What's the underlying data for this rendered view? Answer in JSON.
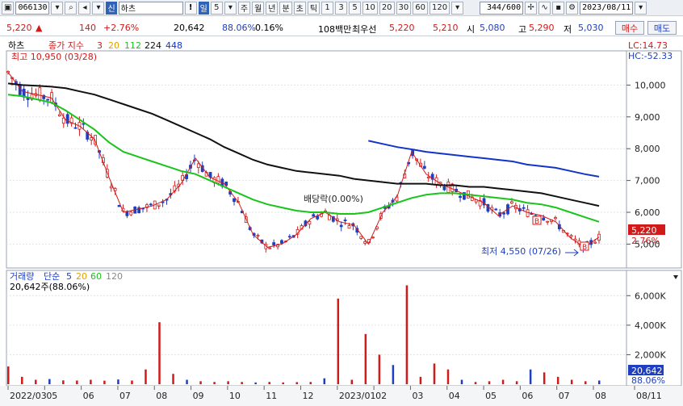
{
  "toolbar": {
    "code": "066130",
    "market_tag": "신",
    "name": "하츠",
    "warn": "!",
    "period_tag": "일",
    "period_num": "5",
    "periods": [
      "주",
      "월",
      "년",
      "분",
      "초",
      "틱"
    ],
    "intervals": [
      "1",
      "3",
      "5",
      "10",
      "20",
      "30",
      "60",
      "120"
    ],
    "count": "344/600",
    "date": "2023/08/11"
  },
  "quote": {
    "price": "5,220",
    "change": "140",
    "change_pct": "+2.76%",
    "volume": "20,642",
    "volume_ratio": "88.06%",
    "turnover": "0.16%",
    "amount_label": "108백만",
    "best_label": "최우선",
    "ask": "5,220",
    "bid": "5,210",
    "open_label": "시",
    "open": "5,080",
    "high_label": "고",
    "high": "5,290",
    "low_label": "저",
    "low": "5,030",
    "buy_label": "매수",
    "sell_label": "매도"
  },
  "price_panel": {
    "name_tag": "하츠",
    "legend_prefix": "종가 지수",
    "ma_periods": [
      "3",
      "20",
      "112",
      "224",
      "448"
    ],
    "high_note": "최고 10,950 (03/28)",
    "low_note": "최저 4,550 (07/26)",
    "dividend_note": "배당락(0.00%)",
    "lc": "LC:14.73",
    "hc": "HC:-52.33",
    "current_price": "5,220",
    "current_pct": "2.76%",
    "b_marker": "B",
    "colors": {
      "ma3": "#d11a1a",
      "ma20": "#e0a000",
      "ma112": "#19c41b",
      "ma224": "#111111",
      "ma448": "#1433c8",
      "up": "#d11a1a",
      "down": "#1f3fbf"
    }
  },
  "volume_panel": {
    "title": "거래량",
    "legend_prefix": "단순",
    "ma_periods": [
      "5",
      "20",
      "60",
      "120"
    ],
    "current": "20,642주(88.06%)",
    "current_value": "20,642",
    "current_pct": "88.06%"
  },
  "chart_data": [
    {
      "type": "candlestick",
      "y_ticks": [
        "10,000",
        "9,000",
        "8,000",
        "7,000",
        "6,000",
        "5,000"
      ],
      "ylim": [
        4300,
        11000
      ],
      "x_ticks": [
        "2022/03",
        "05",
        "06",
        "07",
        "08",
        "09",
        "10",
        "11",
        "12",
        "2023/01",
        "02",
        "03",
        "04",
        "05",
        "06",
        "07",
        "08",
        "08/11"
      ],
      "series": [
        {
          "name": "3",
          "values": [
            10400,
            9800,
            9700,
            9600,
            8900,
            8700,
            8300,
            7100,
            6000,
            6100,
            6200,
            6400,
            6900,
            7700,
            7100,
            6900,
            6300,
            5300,
            4900,
            5000,
            5300,
            5800,
            6000,
            5700,
            5600,
            5000,
            6000,
            6500,
            7900,
            7200,
            6900,
            6700,
            6500,
            6300,
            5900,
            6200,
            6000,
            5900,
            5700,
            5200,
            4900,
            5220
          ]
        },
        {
          "name": "112",
          "values": [
            9700,
            9650,
            9550,
            9450,
            9200,
            8900,
            8600,
            8200,
            7900,
            7750,
            7600,
            7450,
            7300,
            7200,
            7000,
            6800,
            6600,
            6400,
            6250,
            6150,
            6050,
            6000,
            6000,
            5950,
            5950,
            6000,
            6150,
            6300,
            6450,
            6550,
            6600,
            6600,
            6550,
            6500,
            6450,
            6400,
            6300,
            6250,
            6150,
            6000,
            5850,
            5700
          ]
        },
        {
          "name": "224",
          "values": [
            10050,
            10000,
            9980,
            9950,
            9900,
            9800,
            9700,
            9550,
            9400,
            9250,
            9100,
            8900,
            8700,
            8500,
            8300,
            8050,
            7850,
            7650,
            7500,
            7400,
            7300,
            7250,
            7200,
            7150,
            7050,
            7000,
            6950,
            6900,
            6900,
            6900,
            6850,
            6850,
            6800,
            6800,
            6750,
            6700,
            6650,
            6600,
            6500,
            6400,
            6300,
            6200
          ]
        },
        {
          "name": "448",
          "values": [
            null,
            null,
            null,
            null,
            null,
            null,
            null,
            null,
            null,
            null,
            null,
            null,
            null,
            null,
            null,
            null,
            null,
            null,
            null,
            null,
            null,
            null,
            null,
            null,
            null,
            8250,
            8150,
            8050,
            7980,
            7900,
            7850,
            7800,
            7750,
            7700,
            7650,
            7600,
            7500,
            7450,
            7400,
            7300,
            7200,
            7120
          ]
        }
      ]
    },
    {
      "type": "bar",
      "y_ticks": [
        "6,000K",
        "4,000K",
        "2,000K"
      ],
      "ylim": [
        0,
        7000
      ],
      "values": [
        1200,
        500,
        300,
        350,
        260,
        250,
        300,
        240,
        320,
        250,
        1000,
        4200,
        700,
        300,
        200,
        150,
        200,
        150,
        120,
        150,
        120,
        140,
        150,
        400,
        5800,
        300,
        3400,
        2000,
        1300,
        6700,
        500,
        1400,
        1000,
        300,
        150,
        200,
        300,
        200,
        1000,
        800,
        500,
        300,
        200,
        250
      ]
    }
  ]
}
